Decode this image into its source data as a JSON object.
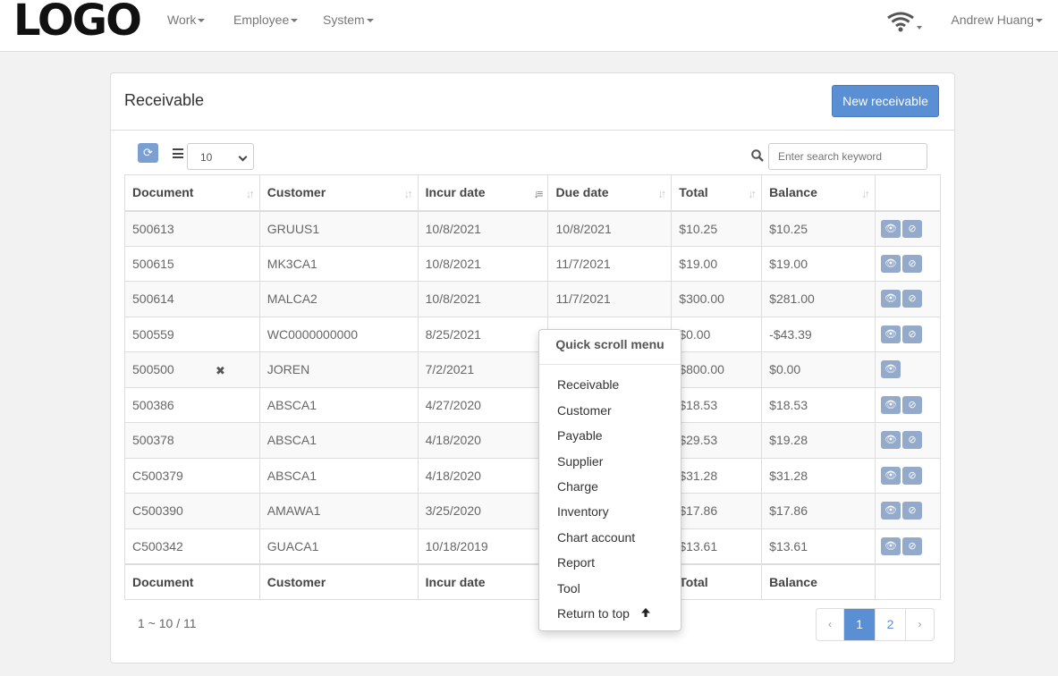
{
  "navbar": {
    "logo": "LOGO",
    "menus": [
      "Work",
      "Employee",
      "System"
    ],
    "status_icon": "wifi-icon",
    "user": "Andrew Huang"
  },
  "panel": {
    "title": "Receivable",
    "new_button": "New receivable"
  },
  "toolbar": {
    "refresh_icon": "refresh-icon",
    "page_size": "10",
    "search_placeholder": "Enter search keyword"
  },
  "table": {
    "columns": [
      "Document",
      "Customer",
      "Incur date",
      "Due date",
      "Total",
      "Balance"
    ],
    "sorted_column": "Incur date",
    "rows": [
      {
        "document": "500613",
        "customer": "GRUUS1",
        "incur": "10/8/2021",
        "due": "10/8/2021",
        "total": "$10.25",
        "balance": "$10.25"
      },
      {
        "document": "500615",
        "customer": "MK3CA1",
        "incur": "10/8/2021",
        "due": "11/7/2021",
        "total": "$19.00",
        "balance": "$19.00"
      },
      {
        "document": "500614",
        "customer": "MALCA2",
        "incur": "10/8/2021",
        "due": "11/7/2021",
        "total": "$300.00",
        "balance": "$281.00"
      },
      {
        "document": "500559",
        "customer": "WC0000000000",
        "incur": "8/25/2021",
        "due": "",
        "total": "$0.00",
        "balance": "-$43.39"
      },
      {
        "document": "500500",
        "customer": "JOREN",
        "incur": "7/2/2021",
        "due": "",
        "total": "$800.00",
        "balance": "$0.00"
      },
      {
        "document": "500386",
        "customer": "ABSCA1",
        "incur": "4/27/2020",
        "due": "",
        "total": "$18.53",
        "balance": "$18.53"
      },
      {
        "document": "500378",
        "customer": "ABSCA1",
        "incur": "4/18/2020",
        "due": "",
        "total": "$29.53",
        "balance": "$19.28"
      },
      {
        "document": "C500379",
        "customer": "ABSCA1",
        "incur": "4/18/2020",
        "due": "",
        "total": "$31.28",
        "balance": "$31.28"
      },
      {
        "document": "C500390",
        "customer": "AMAWA1",
        "incur": "3/25/2020",
        "due": "",
        "total": "$17.86",
        "balance": "$17.86"
      },
      {
        "document": "C500342",
        "customer": "GUACA1",
        "incur": "10/18/2019",
        "due": "",
        "total": "$13.61",
        "balance": "$13.61"
      }
    ],
    "footer": [
      "Document",
      "Customer",
      "Incur date",
      "",
      "Total",
      "Balance"
    ]
  },
  "summary": "1 ~ 10 / 11",
  "pager": {
    "prev": "‹",
    "pages": [
      "1",
      "2"
    ],
    "current": "1",
    "next": "›"
  },
  "scroll_menu": {
    "header": "Quick scroll menu",
    "items": [
      "Receivable",
      "Customer",
      "Payable",
      "Supplier",
      "Charge",
      "Inventory",
      "Chart account",
      "Report",
      "Tool",
      "Return to top"
    ]
  },
  "colors": {
    "primary": "#5b8fd4",
    "overdue": "#a94442",
    "action": "#93aacb"
  }
}
